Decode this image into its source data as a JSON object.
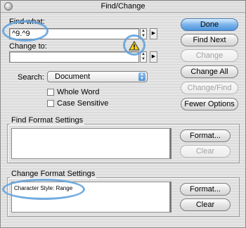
{
  "window": {
    "title": "Find/Change"
  },
  "find": {
    "label": "Find what:",
    "value": "^9.^9"
  },
  "change": {
    "label": "Change to:",
    "value": ""
  },
  "search": {
    "label": "Search:",
    "selected": "Document"
  },
  "options": {
    "whole_word": {
      "label": "Whole Word",
      "checked": false
    },
    "case_sensitive": {
      "label": "Case Sensitive",
      "checked": false
    }
  },
  "buttons": {
    "done": "Done",
    "find_next": "Find Next",
    "change": "Change",
    "change_all": "Change All",
    "change_find": "Change/Find",
    "fewer_options": "Fewer Options"
  },
  "find_format": {
    "title": "Find Format Settings",
    "value": "",
    "format_button": "Format...",
    "clear_button": "Clear"
  },
  "change_format": {
    "title": "Change Format Settings",
    "value": "Character Style: Range",
    "format_button": "Format...",
    "clear_button": "Clear"
  },
  "icons": {
    "warning": "warning-icon",
    "menu_arrow": "triangle-right-icon",
    "spinner": "up-down-icon"
  },
  "colors": {
    "highlight_ring": "#63a3dd",
    "default_button": "#4f95de"
  }
}
